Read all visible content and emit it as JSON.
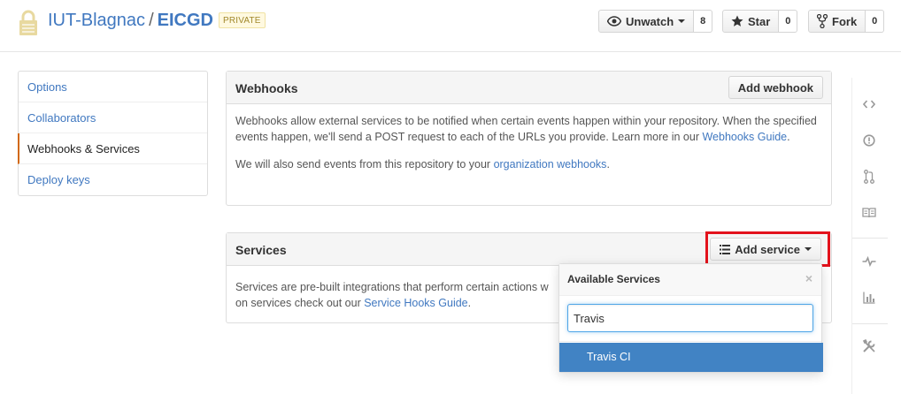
{
  "header": {
    "owner": "IUT-Blagnac",
    "separator": "/",
    "repo": "EICGD",
    "visibility_badge": "PRIVATE",
    "lock_icon": "lock-icon",
    "watch": {
      "label": "Unwatch",
      "count": "8",
      "icon": "eye-icon"
    },
    "star": {
      "label": "Star",
      "count": "0",
      "icon": "star-icon"
    },
    "fork": {
      "label": "Fork",
      "count": "0",
      "icon": "repo-forked-icon"
    }
  },
  "menu": {
    "items": [
      {
        "label": "Options",
        "selected": false
      },
      {
        "label": "Collaborators",
        "selected": false
      },
      {
        "label": "Webhooks & Services",
        "selected": true
      },
      {
        "label": "Deploy keys",
        "selected": false
      }
    ]
  },
  "webhooks": {
    "title": "Webhooks",
    "add_button": "Add webhook",
    "text1": "Webhooks allow external services to be notified when certain events happen within your repository. When the specified events happen, we'll send a POST request to each of the URLs you provide. Learn more in our ",
    "text1_link": "Webhooks Guide",
    "text1_end": ".",
    "text2": "We will also send events from this repository to your ",
    "text2_link": "organization webhooks",
    "text2_end": "."
  },
  "services": {
    "title": "Services",
    "add_button": "Add service",
    "add_icon": "list-icon",
    "text_line1": "Services are pre-built integrations that perform certain actions w",
    "text_line2": "on services check out our ",
    "text_link": "Service Hooks Guide",
    "text_end": "."
  },
  "dropdown": {
    "title": "Available Services",
    "close": "×",
    "filter_value": "Travis",
    "options": [
      {
        "label": "Travis CI",
        "active": true
      }
    ]
  },
  "sidenav": {
    "icons": [
      "code-icon",
      "issue-opened-icon",
      "git-pull-request-icon",
      "book-icon",
      "pulse-icon",
      "graph-icon",
      "tools-icon"
    ]
  },
  "colors": {
    "link": "#4078c0",
    "active_option": "#4183c4",
    "highlight": "#e3121c",
    "selected_menu_border": "#d26911"
  }
}
